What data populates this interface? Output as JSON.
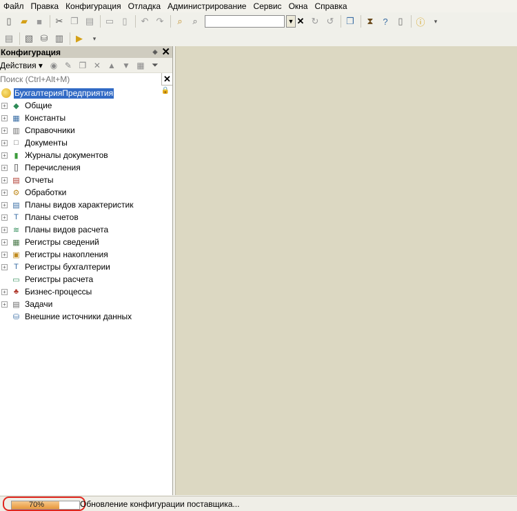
{
  "menu": [
    "Файл",
    "Правка",
    "Конфигурация",
    "Отладка",
    "Администрирование",
    "Сервис",
    "Окна",
    "Справка"
  ],
  "panel": {
    "title": "Конфигурация",
    "actions_label": "Действия",
    "search_placeholder": "Поиск (Ctrl+Alt+M)",
    "root": "БухгалтерияПредприятия",
    "items": [
      {
        "label": "Общие",
        "icon": "shapes-icon",
        "glyph": "◆",
        "color": "#2e8b57",
        "expandable": true
      },
      {
        "label": "Константы",
        "icon": "constants-icon",
        "glyph": "▦",
        "color": "#3a6ea5",
        "expandable": true
      },
      {
        "label": "Справочники",
        "icon": "catalog-icon",
        "glyph": "▥",
        "color": "#6a6a6a",
        "expandable": true
      },
      {
        "label": "Документы",
        "icon": "document-icon",
        "glyph": "□",
        "color": "#6a6a6a",
        "expandable": true
      },
      {
        "label": "Журналы документов",
        "icon": "journal-icon",
        "glyph": "▮",
        "color": "#3b9b3b",
        "expandable": true
      },
      {
        "label": "Перечисления",
        "icon": "enum-icon",
        "glyph": "[]",
        "color": "#555555",
        "expandable": true
      },
      {
        "label": "Отчеты",
        "icon": "report-icon",
        "glyph": "▤",
        "color": "#b03a2e",
        "expandable": true
      },
      {
        "label": "Обработки",
        "icon": "processing-icon",
        "glyph": "⚙",
        "color": "#c08a1c",
        "expandable": true
      },
      {
        "label": "Планы видов характеристик",
        "icon": "characteristics-icon",
        "glyph": "▤",
        "color": "#3a6ea5",
        "expandable": true
      },
      {
        "label": "Планы счетов",
        "icon": "accounts-icon",
        "glyph": "T",
        "color": "#3a6ea5",
        "expandable": true
      },
      {
        "label": "Планы видов расчета",
        "icon": "calculation-icon",
        "glyph": "≋",
        "color": "#2e8b57",
        "expandable": true
      },
      {
        "label": "Регистры сведений",
        "icon": "info-register-icon",
        "glyph": "▦",
        "color": "#4a7a4a",
        "expandable": true
      },
      {
        "label": "Регистры накопления",
        "icon": "accumulation-register-icon",
        "glyph": "▣",
        "color": "#c08a1c",
        "expandable": true
      },
      {
        "label": "Регистры бухгалтерии",
        "icon": "accounting-register-icon",
        "glyph": "T",
        "color": "#3a6ea5",
        "expandable": true
      },
      {
        "label": "Регистры расчета",
        "icon": "calculation-register-icon",
        "glyph": "▭",
        "color": "#2e8b57",
        "expandable": false
      },
      {
        "label": "Бизнес-процессы",
        "icon": "business-process-icon",
        "glyph": "♣",
        "color": "#b03a2e",
        "expandable": true
      },
      {
        "label": "Задачи",
        "icon": "tasks-icon",
        "glyph": "▤",
        "color": "#6a6a6a",
        "expandable": true
      },
      {
        "label": "Внешние источники данных",
        "icon": "external-data-icon",
        "glyph": "⛁",
        "color": "#3a6ea5",
        "expandable": false
      }
    ]
  },
  "status": {
    "progress_text": "70%",
    "progress_value": 0.7,
    "message": "Обновление конфигурации поставщика..."
  }
}
